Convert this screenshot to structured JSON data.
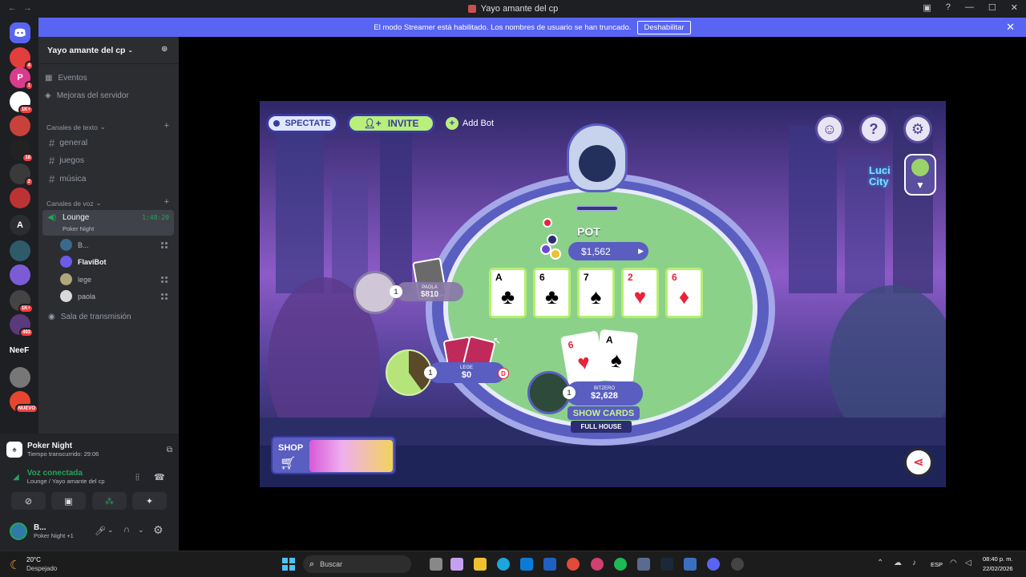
{
  "titlebar": {
    "title": "Yayo amante del cp",
    "time": "1:48:20"
  },
  "banner": {
    "text": "El modo Streamer está habilitado. Los nombres de usuario se han truncado.",
    "button": "Deshabilitar"
  },
  "rail": {
    "servers": [
      {
        "color": "#e23e3e",
        "label": "",
        "badge": "4"
      },
      {
        "color": "#d93c8a",
        "label": "P",
        "badge": "1"
      },
      {
        "color": "#ffffff",
        "label": "",
        "badge": "1K+"
      },
      {
        "color": "#c7423a",
        "label": "",
        "badge": ""
      },
      {
        "color": "#222222",
        "label": "",
        "badge": "18"
      },
      {
        "color": "#3a3a3a",
        "label": "",
        "badge": "2"
      },
      {
        "color": "#b33",
        "label": "",
        "badge": ""
      },
      {
        "color": "#2b2d31",
        "label": "A",
        "badge": ""
      },
      {
        "color": "#2e5a6a",
        "label": "",
        "badge": ""
      },
      {
        "color": "#7b5cd6",
        "label": "",
        "badge": ""
      },
      {
        "color": "#444",
        "label": "",
        "badge": "1K+"
      },
      {
        "color": "#5a3a7a",
        "label": "",
        "badge": "493"
      },
      {
        "color": "#2b2d31",
        "label": "NeeF",
        "badge": ""
      },
      {
        "color": "#777",
        "label": "",
        "badge": ""
      },
      {
        "color": "#e5462f",
        "label": "",
        "badge": "NUEVO"
      }
    ]
  },
  "sidebar": {
    "server_name": "Yayo amante del cp",
    "top_items": [
      {
        "label": "Eventos"
      },
      {
        "label": "Mejoras del servidor"
      }
    ],
    "text_category": "Canales de texto",
    "text_channels": [
      "general",
      "juegos",
      "música"
    ],
    "voice_category": "Canales de voz",
    "voice_channel": {
      "name": "Lounge",
      "activity": "Poker Night",
      "time": "1:48:20"
    },
    "voice_users": [
      "B...",
      "FlaviBot",
      "lege",
      "paola"
    ],
    "stage": "Sala de transmisión"
  },
  "panel": {
    "activity_name": "Poker Night",
    "activity_time": "Tiempo transcurrido: 29:06",
    "voice_status": "Voz conectada",
    "voice_location": "Lounge / Yayo amante del cp",
    "user_name": "B...",
    "user_status": "Poker Night +1"
  },
  "game": {
    "spectate": "SPECTATE",
    "invite": "INVITE",
    "add_bot": "Add Bot",
    "pot_label": "POT",
    "pot_value": "$1,562",
    "board": [
      {
        "rank": "A",
        "suit": "♣",
        "color": "black"
      },
      {
        "rank": "6",
        "suit": "♣",
        "color": "black"
      },
      {
        "rank": "7",
        "suit": "♠",
        "color": "black"
      },
      {
        "rank": "2",
        "suit": "♥",
        "color": "red"
      },
      {
        "rank": "6",
        "suit": "♦",
        "color": "red"
      }
    ],
    "hand": [
      {
        "rank": "6",
        "suit": "♥",
        "color": "red"
      },
      {
        "rank": "A",
        "suit": "♠",
        "color": "black"
      }
    ],
    "players": [
      {
        "name": "PAOLA",
        "stack": "$810",
        "level": "1"
      },
      {
        "name": "LEGE",
        "stack": "$0",
        "level": "1",
        "dealer": "D"
      },
      {
        "name": "BITZERO",
        "stack": "$2,628",
        "level": "1"
      }
    ],
    "show_cards": "SHOW CARDS",
    "hand_name": "FULL HOUSE",
    "shop": "SHOP",
    "city_sign": "Luci City"
  },
  "taskbar": {
    "weather_temp": "20°C",
    "weather_desc": "Despejado",
    "search": "Buscar",
    "lang": "ESP",
    "clock_time": "08:40 p. m.",
    "clock_date": "22/02/2026"
  }
}
